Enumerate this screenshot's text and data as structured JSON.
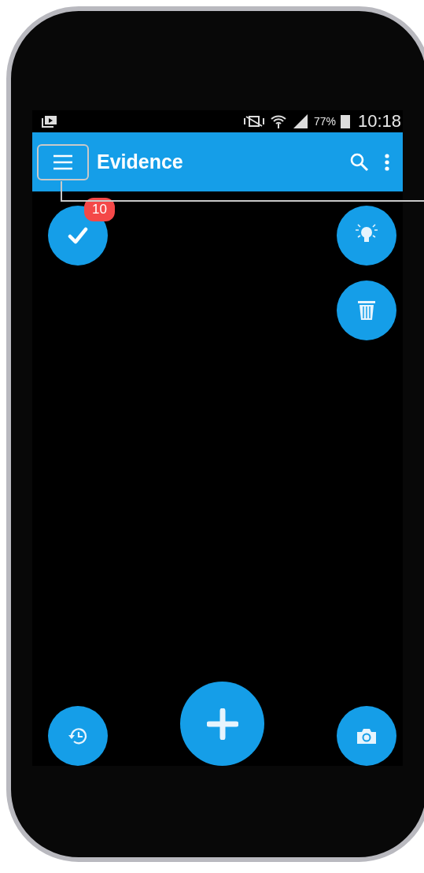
{
  "status_bar": {
    "battery": "77%",
    "time": "10:18"
  },
  "app_bar": {
    "title": "Evidence",
    "menu_highlighted": true
  },
  "badge": "10"
}
